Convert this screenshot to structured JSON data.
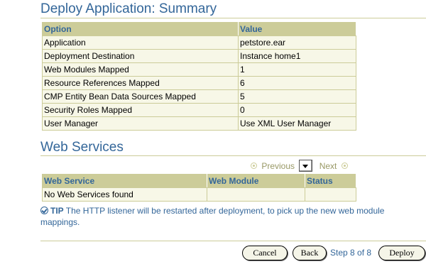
{
  "summary": {
    "title": "Deploy Application: Summary",
    "headers": [
      "Option",
      "Value"
    ],
    "rows": [
      [
        "Application",
        "petstore.ear"
      ],
      [
        "Deployment Destination",
        "Instance home1"
      ],
      [
        "Web Modules Mapped",
        "1"
      ],
      [
        "Resource References Mapped",
        "6"
      ],
      [
        "CMP Entity Bean Data Sources Mapped",
        "5"
      ],
      [
        "Security Roles Mapped",
        "0"
      ],
      [
        "User Manager",
        "Use XML User Manager"
      ]
    ]
  },
  "web_services": {
    "title": "Web Services",
    "nav": {
      "previous": "Previous",
      "next": "Next"
    },
    "headers": [
      "Web Service",
      "Web Module",
      "Status"
    ],
    "empty_message": "No Web Services found"
  },
  "tip": {
    "label": "TIP",
    "text": "The HTTP listener will be restarted after deployment, to pick up the new web module mappings."
  },
  "footer": {
    "cancel": "Cancel",
    "back": "Back",
    "step": "Step 8 of 8",
    "deploy": "Deploy"
  },
  "colors": {
    "accent": "#336699",
    "header_bg": "#cccc99",
    "row_bg": "#f7f7e7",
    "disabled_nav": "#999966"
  }
}
